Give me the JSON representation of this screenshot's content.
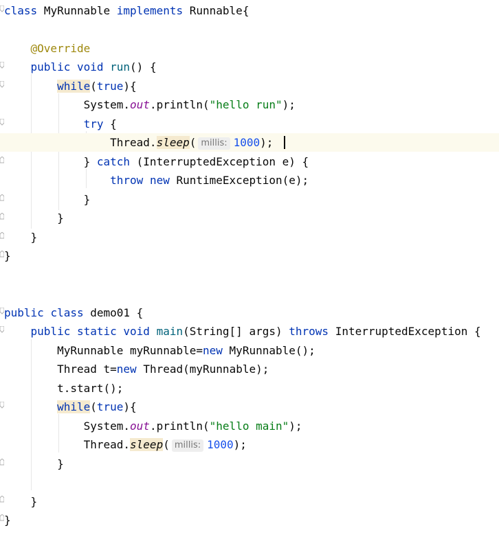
{
  "editor": {
    "language": "Java",
    "colors": {
      "keyword": "#0033b3",
      "method": "#00627a",
      "string": "#067d17",
      "number": "#1750eb",
      "annotation": "#9e880d",
      "field": "#871094",
      "current_line": "#fcfaed",
      "keyword_highlight": "#f5eacf"
    },
    "tokens": {
      "class": "class",
      "implements": "implements",
      "public": "public",
      "void": "void",
      "static": "static",
      "while": "while",
      "true": "true",
      "try": "try",
      "catch": "catch",
      "throw": "throw",
      "throws": "throws",
      "new": "new",
      "class_myrunnable": "MyRunnable",
      "runnable": "Runnable",
      "override": "@Override",
      "run": "run",
      "main": "main",
      "system": "System",
      "out": "out",
      "println": "println",
      "thread": "Thread",
      "sleep": "sleep",
      "interrupted_exception": "InterruptedException",
      "runtime_exception": "RuntimeException",
      "demo01": "demo01",
      "string_type": "String[]",
      "args": "args",
      "my_runnable_var": "myRunnable",
      "t_var": "t",
      "start": "start",
      "e_var": "e",
      "hello_run": "\"hello run\"",
      "hello_main": "\"hello main\"",
      "num_1000": "1000",
      "hint_millis": "millis:"
    }
  }
}
